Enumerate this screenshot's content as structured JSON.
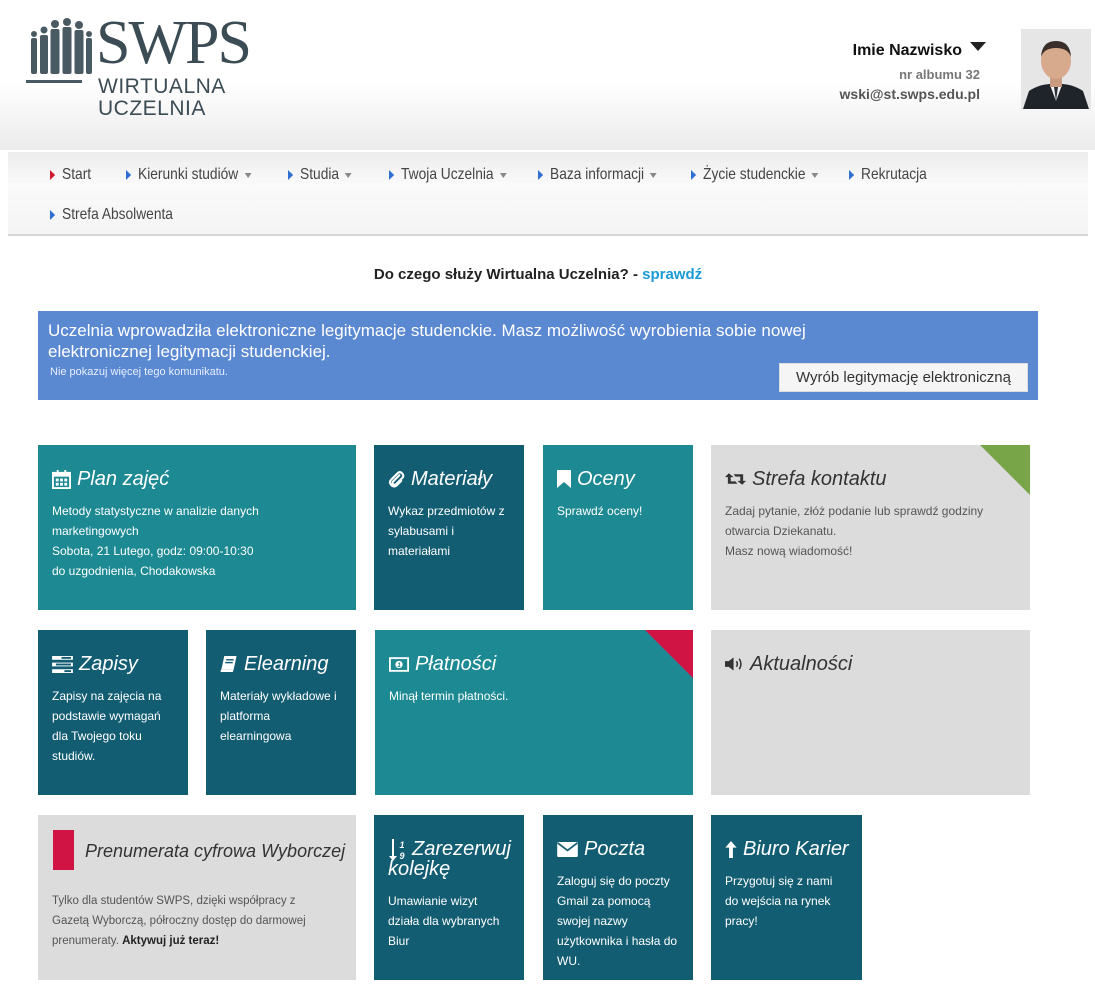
{
  "header": {
    "logo": {
      "brand": "SWPS",
      "line1": "WIRTUALNA",
      "line2": "UCZELNIA"
    },
    "user": {
      "name": "Imie Nazwisko",
      "album": "nr albumu 32",
      "email": "wski@st.swps.edu.pl"
    }
  },
  "nav": {
    "items": [
      {
        "label": "Start",
        "dropdown": false,
        "active": true
      },
      {
        "label": "Kierunki studiów",
        "dropdown": true
      },
      {
        "label": "Studia",
        "dropdown": true
      },
      {
        "label": "Twoja Uczelnia",
        "dropdown": true
      },
      {
        "label": "Baza informacji",
        "dropdown": true
      },
      {
        "label": "Życie studenckie",
        "dropdown": true
      },
      {
        "label": "Rekrutacja",
        "dropdown": false
      },
      {
        "label": "Strefa Absolwenta",
        "dropdown": false
      }
    ]
  },
  "info": {
    "text": "Do czego służy Wirtualna Uczelnia? - ",
    "link": "sprawdź"
  },
  "banner": {
    "text": "Uczelnia wprowadziła elektroniczne legitymacje studenckie. Masz możliwość wyrobienia sobie nowej elektronicznej legitymacji studenckiej.",
    "hide_link": "Nie pokazuj więcej tego komunikatu.",
    "button": "Wyrób legitymację elektroniczną"
  },
  "tiles": {
    "plan": {
      "title": "Plan zajęć",
      "lines": [
        "Metody statystyczne w analizie danych",
        "marketingowych",
        "Sobota, 21 Lutego, godz: 09:00-10:30",
        "do uzgodnienia, Chodakowska"
      ]
    },
    "materialy": {
      "title": "Materiały",
      "lines": [
        "Wykaz przedmiotów z",
        "sylabusami i",
        "materiałami"
      ]
    },
    "oceny": {
      "title": "Oceny",
      "lines": [
        "Sprawdź oceny!"
      ]
    },
    "kontakt": {
      "title": "Strefa kontaktu",
      "lines": [
        "Zadaj pytanie, złóż podanie lub sprawdź godziny",
        "otwarcia Dziekanatu.",
        "Masz nową wiadomość!"
      ]
    },
    "zapisy": {
      "title": "Zapisy",
      "lines": [
        "Zapisy na zajęcia na",
        "podstawie wymagań",
        "dla Twojego toku",
        "studiów."
      ]
    },
    "elearning": {
      "title": "Elearning",
      "lines": [
        "Materiały wykładowe i",
        "platforma",
        "elearningowa"
      ]
    },
    "platnosci": {
      "title": "Płatności",
      "lines": [
        "Minął termin płatności."
      ]
    },
    "aktualnosci": {
      "title": "Aktualności"
    },
    "prenumerata": {
      "title": "Prenumerata cyfrowa Wyborczej",
      "lines": [
        "Tylko dla studentów SWPS, dzięki współpracy z",
        "Gazetą Wyborczą, półroczny dostęp do darmowej"
      ],
      "last_line": "prenumeraty. ",
      "cta": "Aktywuj już teraz!"
    },
    "kolejka": {
      "title_line1": "Zarezerwuj",
      "title_line2": "kolejkę",
      "lines": [
        "Umawianie wizyt",
        "działa dla wybranych",
        "Biur"
      ]
    },
    "poczta": {
      "title": "Poczta",
      "lines": [
        "Zaloguj się do poczty",
        "Gmail za pomocą",
        "swojej nazwy",
        "użytkownika i hasła do",
        "WU."
      ]
    },
    "kariera": {
      "title": "Biuro Karier",
      "lines": [
        "Przygotuj się z nami",
        "do wejścia na rynek",
        "pracy!"
      ]
    }
  },
  "colors": {
    "teal": "#1c8993",
    "dark_teal": "#135d73",
    "tile_gray": "#dcdcdc",
    "banner_blue": "#5a88d1",
    "link_blue": "#1a9ad6",
    "accent_red": "#d01545",
    "accent_green": "#78a547"
  }
}
